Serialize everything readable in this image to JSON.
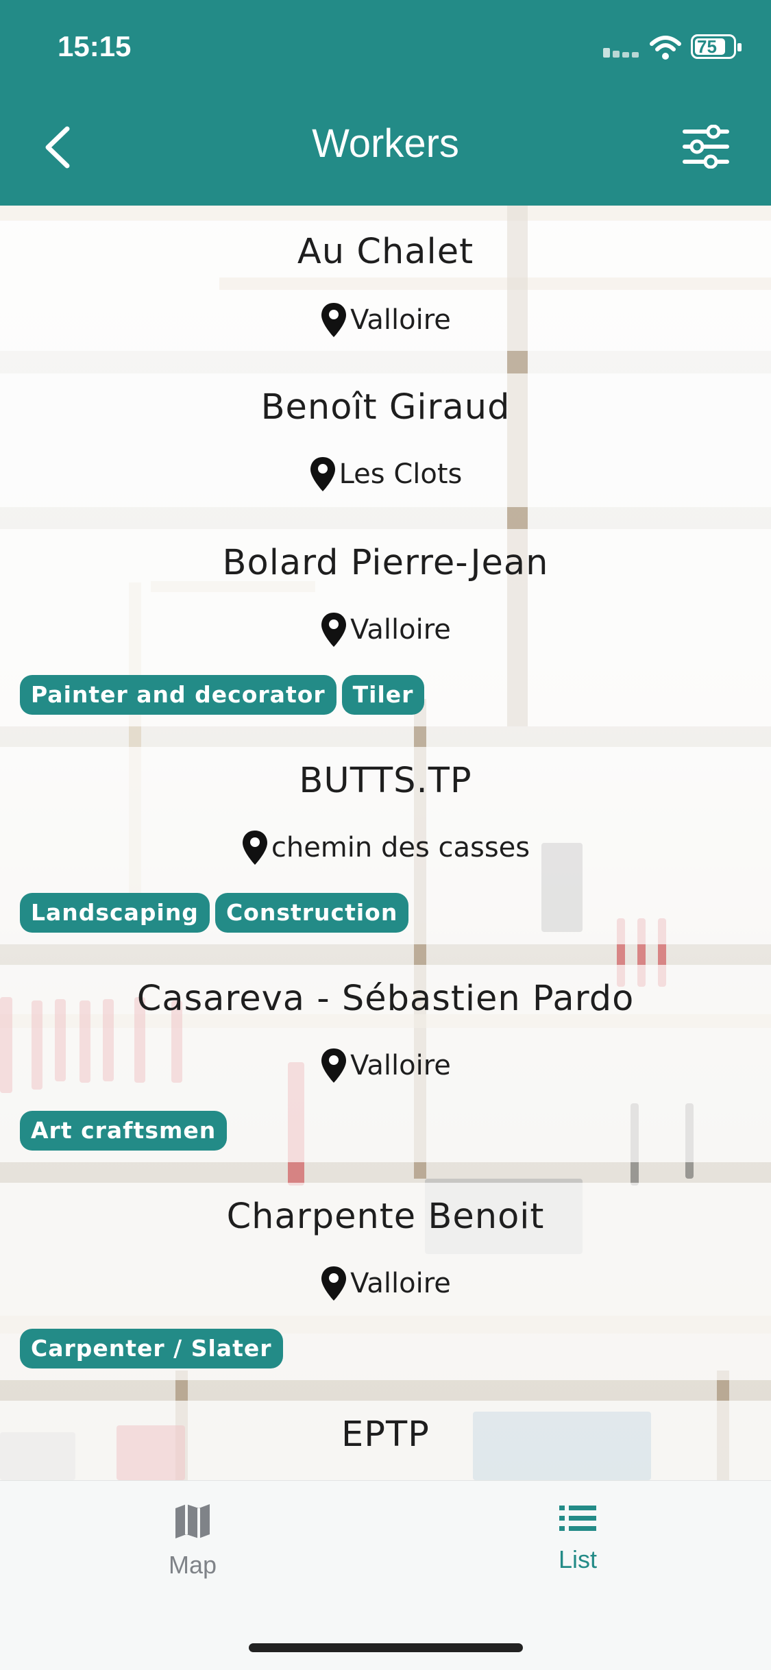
{
  "status_bar": {
    "time": "15:15",
    "battery": "75"
  },
  "header": {
    "title": "Workers"
  },
  "workers": [
    {
      "name": "Au Chalet",
      "location": "Valloire",
      "tags": []
    },
    {
      "name": "Benoît Giraud",
      "location": "Les Clots",
      "tags": []
    },
    {
      "name": "Bolard Pierre-Jean",
      "location": "Valloire",
      "tags": [
        "Painter and decorator",
        "Tiler"
      ]
    },
    {
      "name": "BUTTS.TP",
      "location": "chemin des casses",
      "tags": [
        "Landscaping",
        "Construction"
      ]
    },
    {
      "name": "Casareva - Sébastien Pardo",
      "location": "Valloire",
      "tags": [
        "Art craftsmen"
      ]
    },
    {
      "name": "Charpente Benoit",
      "location": "Valloire",
      "tags": [
        "Carpenter / Slater"
      ]
    },
    {
      "name": "EPTP",
      "location": "",
      "tags": []
    }
  ],
  "tabbar": {
    "map_label": "Map",
    "list_label": "List",
    "active": "List"
  },
  "colors": {
    "accent": "#238b87",
    "text": "#1e1e1e",
    "inactive": "#7f8388"
  },
  "icons": {
    "back": "chevron-left-icon",
    "filter": "sliders-icon",
    "location": "map-pin-icon",
    "map": "map-icon",
    "list": "list-icon"
  }
}
